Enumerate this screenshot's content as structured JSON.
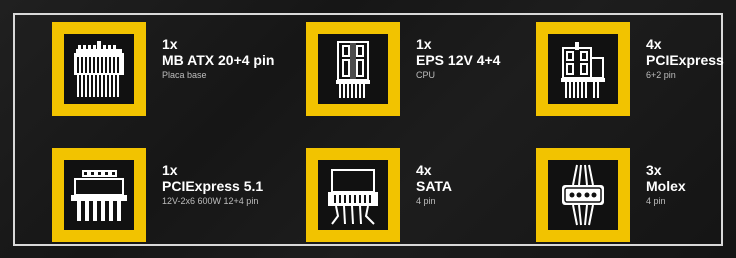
{
  "connectors": [
    {
      "qty": "1x",
      "name": "MB ATX 20+4 pin",
      "sub": "Placa base",
      "icon": "atx-24pin-connector-icon"
    },
    {
      "qty": "1x",
      "name": "EPS 12V 4+4",
      "sub": "CPU",
      "icon": "eps-8pin-connector-icon"
    },
    {
      "qty": "4x",
      "name": "PCIExpress",
      "sub": "6+2 pin",
      "icon": "pcie-6plus2-connector-icon"
    },
    {
      "qty": "1x",
      "name": "PCIExpress 5.1",
      "sub": "12V-2x6 600W  12+4 pin",
      "icon": "pcie-12vhpwr-connector-icon"
    },
    {
      "qty": "4x",
      "name": "SATA",
      "sub": "4 pin",
      "icon": "sata-connector-icon"
    },
    {
      "qty": "3x",
      "name": "Molex",
      "sub": "4 pin",
      "icon": "molex-connector-icon"
    }
  ],
  "colors": {
    "accent": "#f2c300",
    "border": "#d9d9d9",
    "background": "#1a1a1a"
  }
}
